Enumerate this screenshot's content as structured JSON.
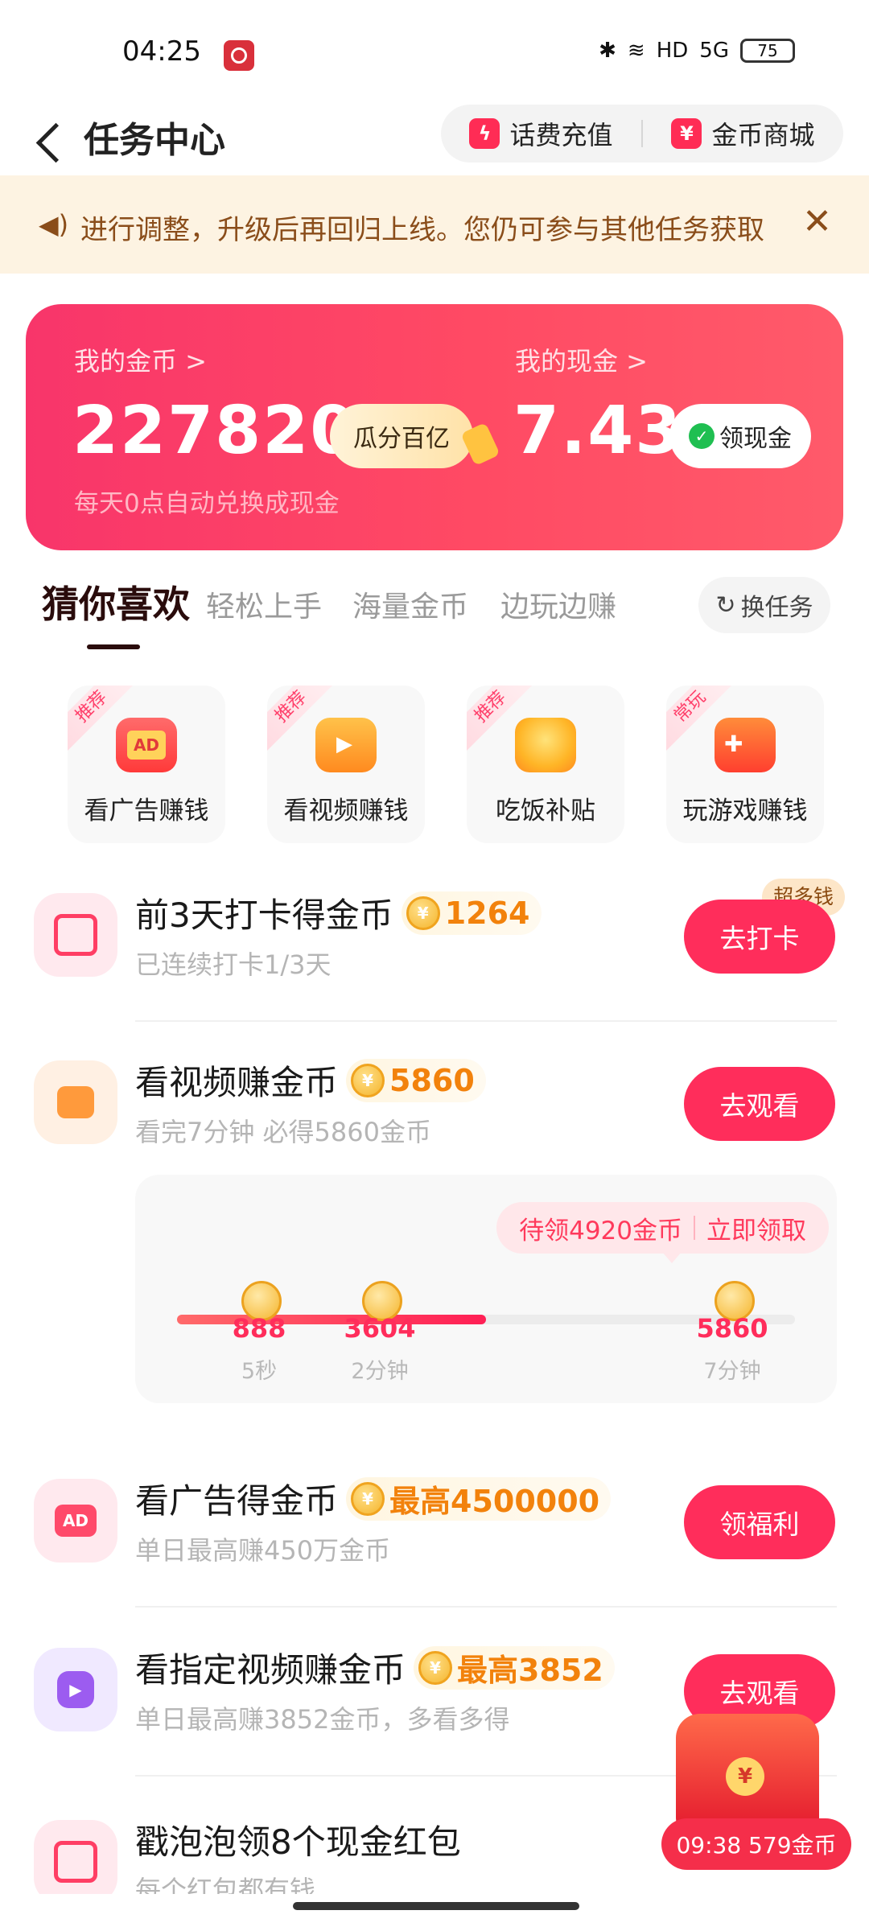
{
  "status_bar": {
    "time": "04:25",
    "network": "5G",
    "hd": "HD",
    "battery": "75"
  },
  "header": {
    "title": "任务中心",
    "phone_recharge": "话费充值",
    "coin_mall": "金币商城"
  },
  "notice": {
    "text": "进行调整，升级后再回归上线。您仍可参与其他任务获取"
  },
  "wallet": {
    "coins_label": "我的金币 >",
    "coins": "227820",
    "split_button": "瓜分百亿",
    "cash_label": "我的现金 >",
    "cash": "7.43",
    "claim_cash": "领现金",
    "note": "每天0点自动兑换成现金"
  },
  "tabs": {
    "items": [
      "猜你喜欢",
      "轻松上手",
      "海量金币",
      "边玩边赚"
    ],
    "swap": "换任务"
  },
  "quick_cards": [
    {
      "tag": "推荐",
      "label": "看广告赚钱"
    },
    {
      "tag": "推荐",
      "label": "看视频赚钱"
    },
    {
      "tag": "推荐",
      "label": "吃饭补贴"
    },
    {
      "tag": "常玩",
      "label": "玩游戏赚钱"
    }
  ],
  "tasks": [
    {
      "title": "前3天打卡得金币",
      "reward": "1264",
      "desc": "已连续打卡1/3天",
      "button": "去打卡",
      "badge": "超多钱"
    },
    {
      "title": "看视频赚金币",
      "reward": "5860",
      "desc": "看完7分钟 必得5860金币",
      "button": "去观看"
    },
    {
      "title": "看广告得金币",
      "reward": "最高4500000",
      "desc": "单日最高赚450万金币",
      "button": "领福利"
    },
    {
      "title": "看指定视频赚金币",
      "reward": "最高3852",
      "desc": "单日最高赚3852金币，多看多得",
      "button": "去观看"
    },
    {
      "title": "戳泡泡领8个现金红包",
      "desc": "每个红包都有钱"
    }
  ],
  "video_progress": {
    "pending": "待领4920金币",
    "claim": "立即领取",
    "fill_fraction": 0.5,
    "nodes": [
      {
        "value": "888",
        "time": "5秒"
      },
      {
        "value": "3604",
        "time": "2分钟"
      },
      {
        "value": "5860",
        "time": "7分钟"
      }
    ]
  },
  "float_widget": {
    "label": "09:38 579金币"
  }
}
